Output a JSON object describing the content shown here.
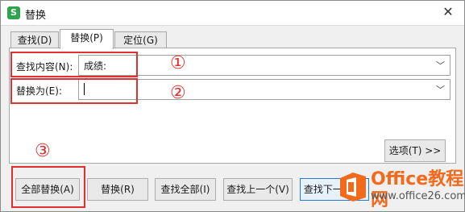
{
  "window": {
    "title": "替换",
    "app_icon_letter": "S",
    "close_glyph": "✕"
  },
  "tabs": [
    {
      "label": "查找(D)",
      "active": false
    },
    {
      "label": "替换(P)",
      "active": true
    },
    {
      "label": "定位(G)",
      "active": false
    }
  ],
  "find": {
    "label": "查找内容(N):",
    "value": "成绩:"
  },
  "replace": {
    "label": "替换为(E):",
    "value": ""
  },
  "options_button": "选项(T) >>",
  "buttons": {
    "replace_all": "全部替换(A)",
    "replace": "替换(R)",
    "find_all": "查找全部(I)",
    "find_prev": "查找上一个(V)",
    "find_next": "查找下一个(F)"
  },
  "annotations": [
    "①",
    "②",
    "③"
  ],
  "watermark": {
    "brand": "Office教程网",
    "url": "www.office26.com"
  },
  "colors": {
    "annotation_red": "#e03030",
    "watermark_orange": "#f26b1d",
    "app_green": "#2ea44f"
  }
}
